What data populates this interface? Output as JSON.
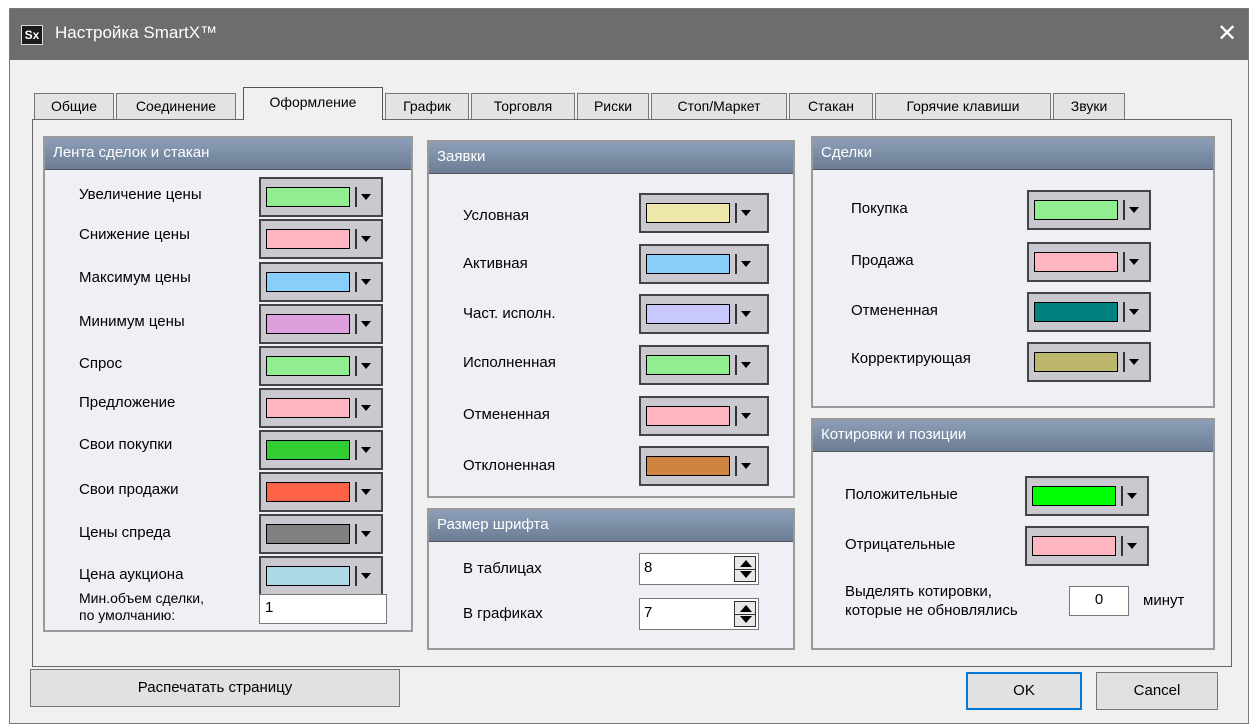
{
  "window": {
    "title": "Настройка SmartX™",
    "icon_text": "Sx",
    "close_glyph": "✕"
  },
  "tabs": [
    "Общие",
    "Соединение",
    "Оформление",
    "График",
    "Торговля",
    "Риски",
    "Стоп/Маркет",
    "Стакан",
    "Горячие клавиши",
    "Звуки"
  ],
  "active_tab": "Оформление",
  "tape": {
    "header": "Лента сделок и стакан",
    "items": [
      {
        "label": "Увеличение цены",
        "color": "#90ee90"
      },
      {
        "label": "Снижение цены",
        "color": "#ffb6c1"
      },
      {
        "label": "Максимум цены",
        "color": "#87cefa"
      },
      {
        "label": "Минимум цены",
        "color": "#dda0dd"
      },
      {
        "label": "Спрос",
        "color": "#90ee90"
      },
      {
        "label": "Предложение",
        "color": "#ffb6c1"
      },
      {
        "label": "Свои покупки",
        "color": "#32cd32"
      },
      {
        "label": "Свои продажи",
        "color": "#ff6347"
      },
      {
        "label": "Цены спреда",
        "color": "#808080"
      },
      {
        "label": "Цена аукциона",
        "color": "#add8e6"
      }
    ],
    "min_volume_label_1": "Мин.объем сделки,",
    "min_volume_label_2": "по умолчанию:",
    "min_volume_value": "1"
  },
  "orders": {
    "header": "Заявки",
    "items": [
      {
        "label": "Условная",
        "color": "#eee8aa"
      },
      {
        "label": "Активная",
        "color": "#87cefa"
      },
      {
        "label": "Част. исполн.",
        "color": "#c8c8ff"
      },
      {
        "label": "Исполненная",
        "color": "#90ee90"
      },
      {
        "label": "Отмененная",
        "color": "#ffb6c1"
      },
      {
        "label": "Отклоненная",
        "color": "#cd853f"
      }
    ]
  },
  "font_size": {
    "header": "Размер шрифта",
    "tables_label": "В таблицах",
    "tables_value": "8",
    "charts_label": "В графиках",
    "charts_value": "7"
  },
  "deals": {
    "header": "Сделки",
    "items": [
      {
        "label": "Покупка",
        "color": "#90ee90"
      },
      {
        "label": "Продажа",
        "color": "#ffb6c1"
      },
      {
        "label": "Отмененная",
        "color": "#008080"
      },
      {
        "label": "Корректирующая",
        "color": "#bdb76b"
      }
    ]
  },
  "quotes": {
    "header": "Котировки и позиции",
    "items": [
      {
        "label": "Положительные",
        "color": "#00ff00"
      },
      {
        "label": "Отрицательные",
        "color": "#ffb6c1"
      }
    ],
    "highlight_label_1": "Выделять котировки,",
    "highlight_label_2": "которые не обновлялись",
    "highlight_value": "0",
    "minutes_label": "минут"
  },
  "buttons": {
    "print": "Распечатать страницу",
    "ok": "OK",
    "cancel": "Cancel"
  }
}
